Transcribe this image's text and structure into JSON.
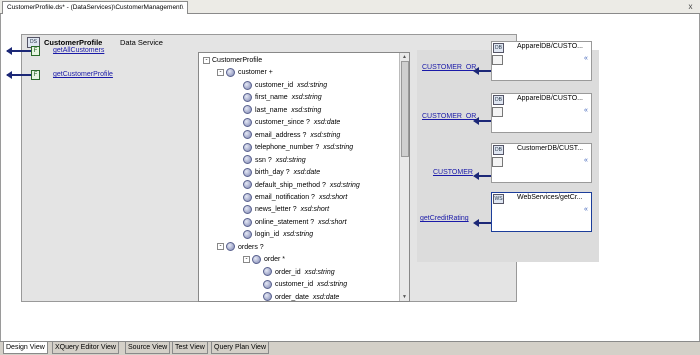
{
  "editor_tab": {
    "title": "CustomerProfile.ds* - (DataServices)\\CustomerManagement\\",
    "close_glyph": "x"
  },
  "data_service": {
    "icon_text": "DS",
    "name": "CustomerProfile",
    "type_label": "Data Service"
  },
  "functions": [
    {
      "icon_text": "F",
      "label": "getAllCustomers"
    },
    {
      "icon_text": "F",
      "label": "getCustomerProfile"
    }
  ],
  "tree": {
    "rows": [
      {
        "toggle": "-",
        "label": "CustomerProfile",
        "type": "",
        "has_node": false
      },
      {
        "toggle": "-",
        "label": "customer +",
        "type": "",
        "has_node": true
      },
      {
        "toggle": "",
        "label": "customer_id",
        "type": "xsd:string",
        "has_node": true
      },
      {
        "toggle": "",
        "label": "first_name",
        "type": "xsd:string",
        "has_node": true
      },
      {
        "toggle": "",
        "label": "last_name",
        "type": "xsd:string",
        "has_node": true
      },
      {
        "toggle": "",
        "label": "customer_since ?",
        "type": "xsd:date",
        "has_node": true
      },
      {
        "toggle": "",
        "label": "email_address ?",
        "type": "xsd:string",
        "has_node": true
      },
      {
        "toggle": "",
        "label": "telephone_number ?",
        "type": "xsd:string",
        "has_node": true
      },
      {
        "toggle": "",
        "label": "ssn ?",
        "type": "xsd:string",
        "has_node": true
      },
      {
        "toggle": "",
        "label": "birth_day ?",
        "type": "xsd:date",
        "has_node": true
      },
      {
        "toggle": "",
        "label": "default_ship_method ?",
        "type": "xsd:string",
        "has_node": true
      },
      {
        "toggle": "",
        "label": "email_notification ?",
        "type": "xsd:short",
        "has_node": true
      },
      {
        "toggle": "",
        "label": "news_letter ?",
        "type": "xsd:short",
        "has_node": true
      },
      {
        "toggle": "",
        "label": "online_statement ?",
        "type": "xsd:short",
        "has_node": true
      },
      {
        "toggle": "",
        "label": "login_id",
        "type": "xsd:string",
        "has_node": true
      },
      {
        "toggle": "-",
        "label": "orders ?",
        "type": "",
        "has_node": true
      },
      {
        "toggle": "-",
        "label": "order *",
        "type": "",
        "has_node": true
      },
      {
        "toggle": "",
        "label": "order_id",
        "type": "xsd:string",
        "has_node": true
      },
      {
        "toggle": "",
        "label": "customer_id",
        "type": "xsd:string",
        "has_node": true
      },
      {
        "toggle": "",
        "label": "order_date",
        "type": "xsd:date",
        "has_node": true
      }
    ],
    "scroll_up": "▲",
    "scroll_down": "▼"
  },
  "sources": [
    {
      "label": "CUSTOMER_OR",
      "box_title": "ApparelDB/CUSTO...",
      "icon_text": "DB",
      "chevron": "«"
    },
    {
      "label": "CUSTOMER_OR",
      "box_title": "ApparelDB/CUSTO...",
      "icon_text": "DB",
      "chevron": "«"
    },
    {
      "label": "CUSTOMER",
      "box_title": "CustomerDB/CUST...",
      "icon_text": "DB",
      "chevron": "«"
    },
    {
      "label": "getCreditRating",
      "box_title": "WebServices/getCr...",
      "icon_text": "WS",
      "chevron": "«"
    }
  ],
  "view_tabs": [
    "Design View",
    "XQuery Editor View",
    "Source View",
    "Test View",
    "Query Plan View"
  ],
  "active_view": "Design View",
  "colors": {
    "link": "#1a1aa8",
    "arrow": "#1c2877",
    "panel": "#e4e4e4"
  }
}
